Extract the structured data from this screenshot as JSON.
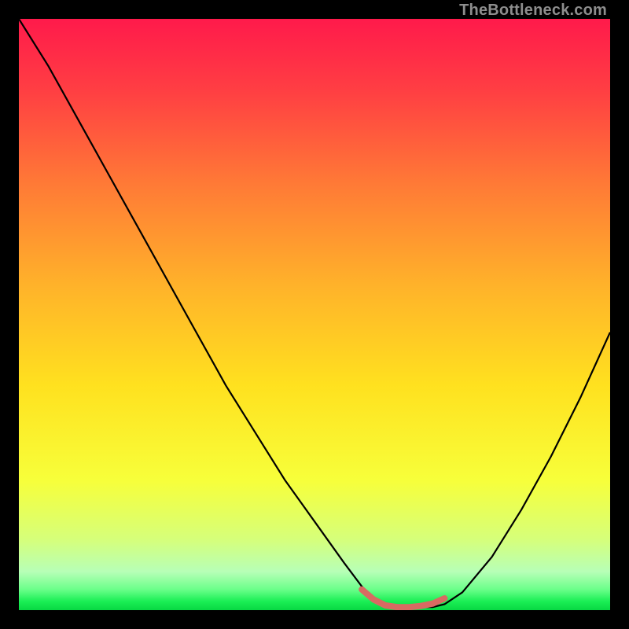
{
  "watermark": "TheBottleneck.com",
  "chart_data": {
    "type": "line",
    "title": "",
    "xlabel": "",
    "ylabel": "",
    "xlim": [
      0,
      100
    ],
    "ylim": [
      0,
      100
    ],
    "series": [
      {
        "name": "bottleneck-curve",
        "x": [
          0,
          5,
          10,
          15,
          20,
          25,
          30,
          35,
          40,
          45,
          50,
          55,
          58,
          60,
          63,
          67,
          70,
          72,
          75,
          80,
          85,
          90,
          95,
          100
        ],
        "y": [
          100,
          92,
          83,
          74,
          65,
          56,
          47,
          38,
          30,
          22,
          15,
          8,
          4,
          2,
          0.5,
          0.5,
          0.5,
          1,
          3,
          9,
          17,
          26,
          36,
          47
        ]
      },
      {
        "name": "sweet-spot-segment",
        "x": [
          58,
          60,
          62,
          64,
          66,
          68,
          70,
          72
        ],
        "y": [
          3.5,
          1.8,
          0.8,
          0.5,
          0.5,
          0.7,
          1.1,
          2.0
        ]
      }
    ],
    "gradient_stops": [
      {
        "offset": 0.0,
        "color": "#ff1a4b"
      },
      {
        "offset": 0.12,
        "color": "#ff3e43"
      },
      {
        "offset": 0.28,
        "color": "#ff7a36"
      },
      {
        "offset": 0.45,
        "color": "#ffb22a"
      },
      {
        "offset": 0.62,
        "color": "#ffe11f"
      },
      {
        "offset": 0.78,
        "color": "#f7ff3a"
      },
      {
        "offset": 0.88,
        "color": "#d6ff7a"
      },
      {
        "offset": 0.935,
        "color": "#b7ffb7"
      },
      {
        "offset": 0.965,
        "color": "#6bff8a"
      },
      {
        "offset": 0.985,
        "color": "#1bef55"
      },
      {
        "offset": 1.0,
        "color": "#08d843"
      }
    ],
    "colors": {
      "curve": "#000000",
      "sweet_spot": "#d86a62",
      "background_border": "#000000"
    }
  }
}
